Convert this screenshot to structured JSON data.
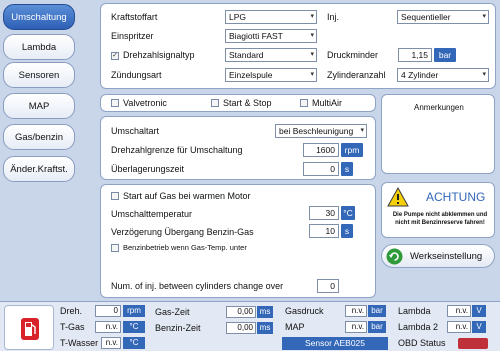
{
  "sidebar": {
    "items": [
      {
        "label": "Umschaltung"
      },
      {
        "label": "Lambda"
      },
      {
        "label": "Sensoren"
      },
      {
        "label": "MAP"
      },
      {
        "label": "Gas/benzin"
      },
      {
        "label": "Änder.Kraftst."
      }
    ]
  },
  "general": {
    "kraftstoffart_label": "Kraftstoffart",
    "kraftstoffart_value": "LPG",
    "inj_label": "Inj.",
    "inj_value": "Sequentieller",
    "einspritzer_label": "Einspritzer",
    "einspritzer_value": "Biagiotti FAST",
    "drehzahl_label": "Drehzahlsignaltyp",
    "drehzahl_value": "Standard",
    "druckminder_label": "Druckminder",
    "druckminder_value": "1,15",
    "druckminder_unit": "bar",
    "zuendungsart_label": "Zündungsart",
    "zuendungsart_value": "Einzelspule",
    "zylinder_label": "Zylinderanzahl",
    "zylinder_value": "4 Zylinder"
  },
  "options": {
    "valvetronic": "Valvetronic",
    "startstop": "Start & Stop",
    "multiair": "MultiAir"
  },
  "umschaltart": {
    "label": "Umschaltart",
    "value": "bei Beschleunigung",
    "drehzahlgrenze_label": "Drehzahlgrenze für Umschaltung",
    "drehzahlgrenze_value": "1600",
    "drehzahlgrenze_unit": "rpm",
    "ueberlagerung_label": "Überlagerungszeit",
    "ueberlagerung_value": "0",
    "ueberlagerung_unit": "s"
  },
  "warm": {
    "start_label": "Start auf Gas bei warmen Motor",
    "temp_label": "Umschalttemperatur",
    "temp_value": "30",
    "temp_unit": "°C",
    "delay_label": "Verzögerung Übergang Benzin-Gas",
    "delay_value": "10",
    "delay_unit": "s",
    "benzin_label": "Benzinbetrieb wenn Gas-Temp. unter",
    "inj_change_label": "Num. of inj. between cylinders change over",
    "inj_change_value": "0"
  },
  "right": {
    "anmerkungen": "Anmerkungen",
    "achtung_title": "ACHTUNG",
    "achtung_text": "Die Pumpe nicht abklemmen und nicht mit Benzinreserve fahren!",
    "werkseinstellung": "Werkseinstellung"
  },
  "status": {
    "dreh_label": "Dreh.",
    "dreh_value": "0",
    "dreh_unit": "rpm",
    "tgas_label": "T-Gas",
    "tgas_value": "n.v.",
    "tgas_unit": "°C",
    "twasser_label": "T-Wasser",
    "twasser_value": "n.v.",
    "twasser_unit": "°C",
    "gaszeit_label": "Gas-Zeit",
    "gaszeit_value": "0,00",
    "gaszeit_unit": "ms",
    "benzinzeit_label": "Benzin-Zeit",
    "benzinzeit_value": "0,00",
    "benzinzeit_unit": "ms",
    "gasdruck_label": "Gasdruck",
    "gasdruck_value": "n.v.",
    "gasdruck_unit": "bar",
    "map_label": "MAP",
    "map_value": "n.v.",
    "map_unit": "bar",
    "sensor_label": "Sensor AEB025",
    "lambda_label": "Lambda",
    "lambda_value": "n.v.",
    "lambda_unit": "V",
    "lambda2_label": "Lambda 2",
    "lambda2_value": "n.v.",
    "lambda2_unit": "V",
    "obd_label": "OBD Status"
  },
  "colors": {
    "accent": "#3367b8",
    "active_tab": "#2d60b5",
    "background": "#c9d6ea",
    "fuel_icon": "#d8232a"
  }
}
